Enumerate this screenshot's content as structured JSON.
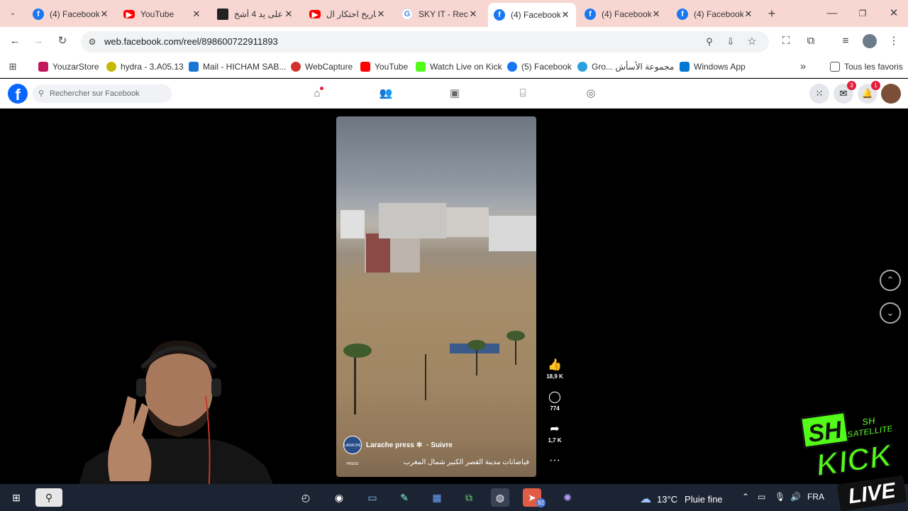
{
  "browser": {
    "tabs": [
      {
        "title": "(4) Facebook",
        "icon": "facebook-icon"
      },
      {
        "title": "YouTube",
        "icon": "youtube-icon"
      },
      {
        "title": "على يد 4 أشخ",
        "icon": "news-icon"
      },
      {
        "title": "تاريخ احتكار ال",
        "icon": "youtube-icon"
      },
      {
        "title": "SKY IT - Rech",
        "icon": "google-icon"
      },
      {
        "title": "(4) Facebook",
        "icon": "facebook-icon",
        "active": true
      },
      {
        "title": "(4) Facebook",
        "icon": "facebook-icon"
      },
      {
        "title": "(4) Facebook",
        "icon": "facebook-icon"
      }
    ],
    "url": "web.facebook.com/reel/898600722911893",
    "bookmarks": [
      {
        "label": "YouzarStore",
        "color": "#c2185b"
      },
      {
        "label": "hydra - 3.A05.13",
        "color": "#c6b800"
      },
      {
        "label": "Mail - HICHAM SAB...",
        "color": "#1976d2"
      },
      {
        "label": "WebCapture",
        "color": "#d32f2f"
      },
      {
        "label": "YouTube",
        "color": "#ff0000"
      },
      {
        "label": "Watch Live on Kick",
        "color": "#53fc18"
      },
      {
        "label": "(5) Facebook",
        "color": "#1877f2"
      },
      {
        "label": "Gro... مجموعة الأسأش",
        "color": "#2aa1dc"
      },
      {
        "label": "Windows App",
        "color": "#0078d4"
      }
    ],
    "all_bookmarks": "Tous les favoris"
  },
  "facebook": {
    "search_placeholder": "Rechercher sur Facebook",
    "messenger_badge": "3",
    "notifications_badge": "1"
  },
  "reel": {
    "author": "Larache press",
    "avatar_text": "LARACHE PRESS",
    "follow": "· Suivre",
    "caption": "فياضانات مدينة القصر الكبير شمال المغرب",
    "likes": "18,9 K",
    "comments": "774",
    "shares": "1,7 K"
  },
  "taskbar": {
    "temperature": "13°C",
    "weather": "Pluie fine",
    "language": "FRA",
    "telegram_badge": "92"
  },
  "overlay": {
    "channel": "SH",
    "sub": "SATELLITE",
    "kick": "KICK",
    "live": "LIVE"
  }
}
